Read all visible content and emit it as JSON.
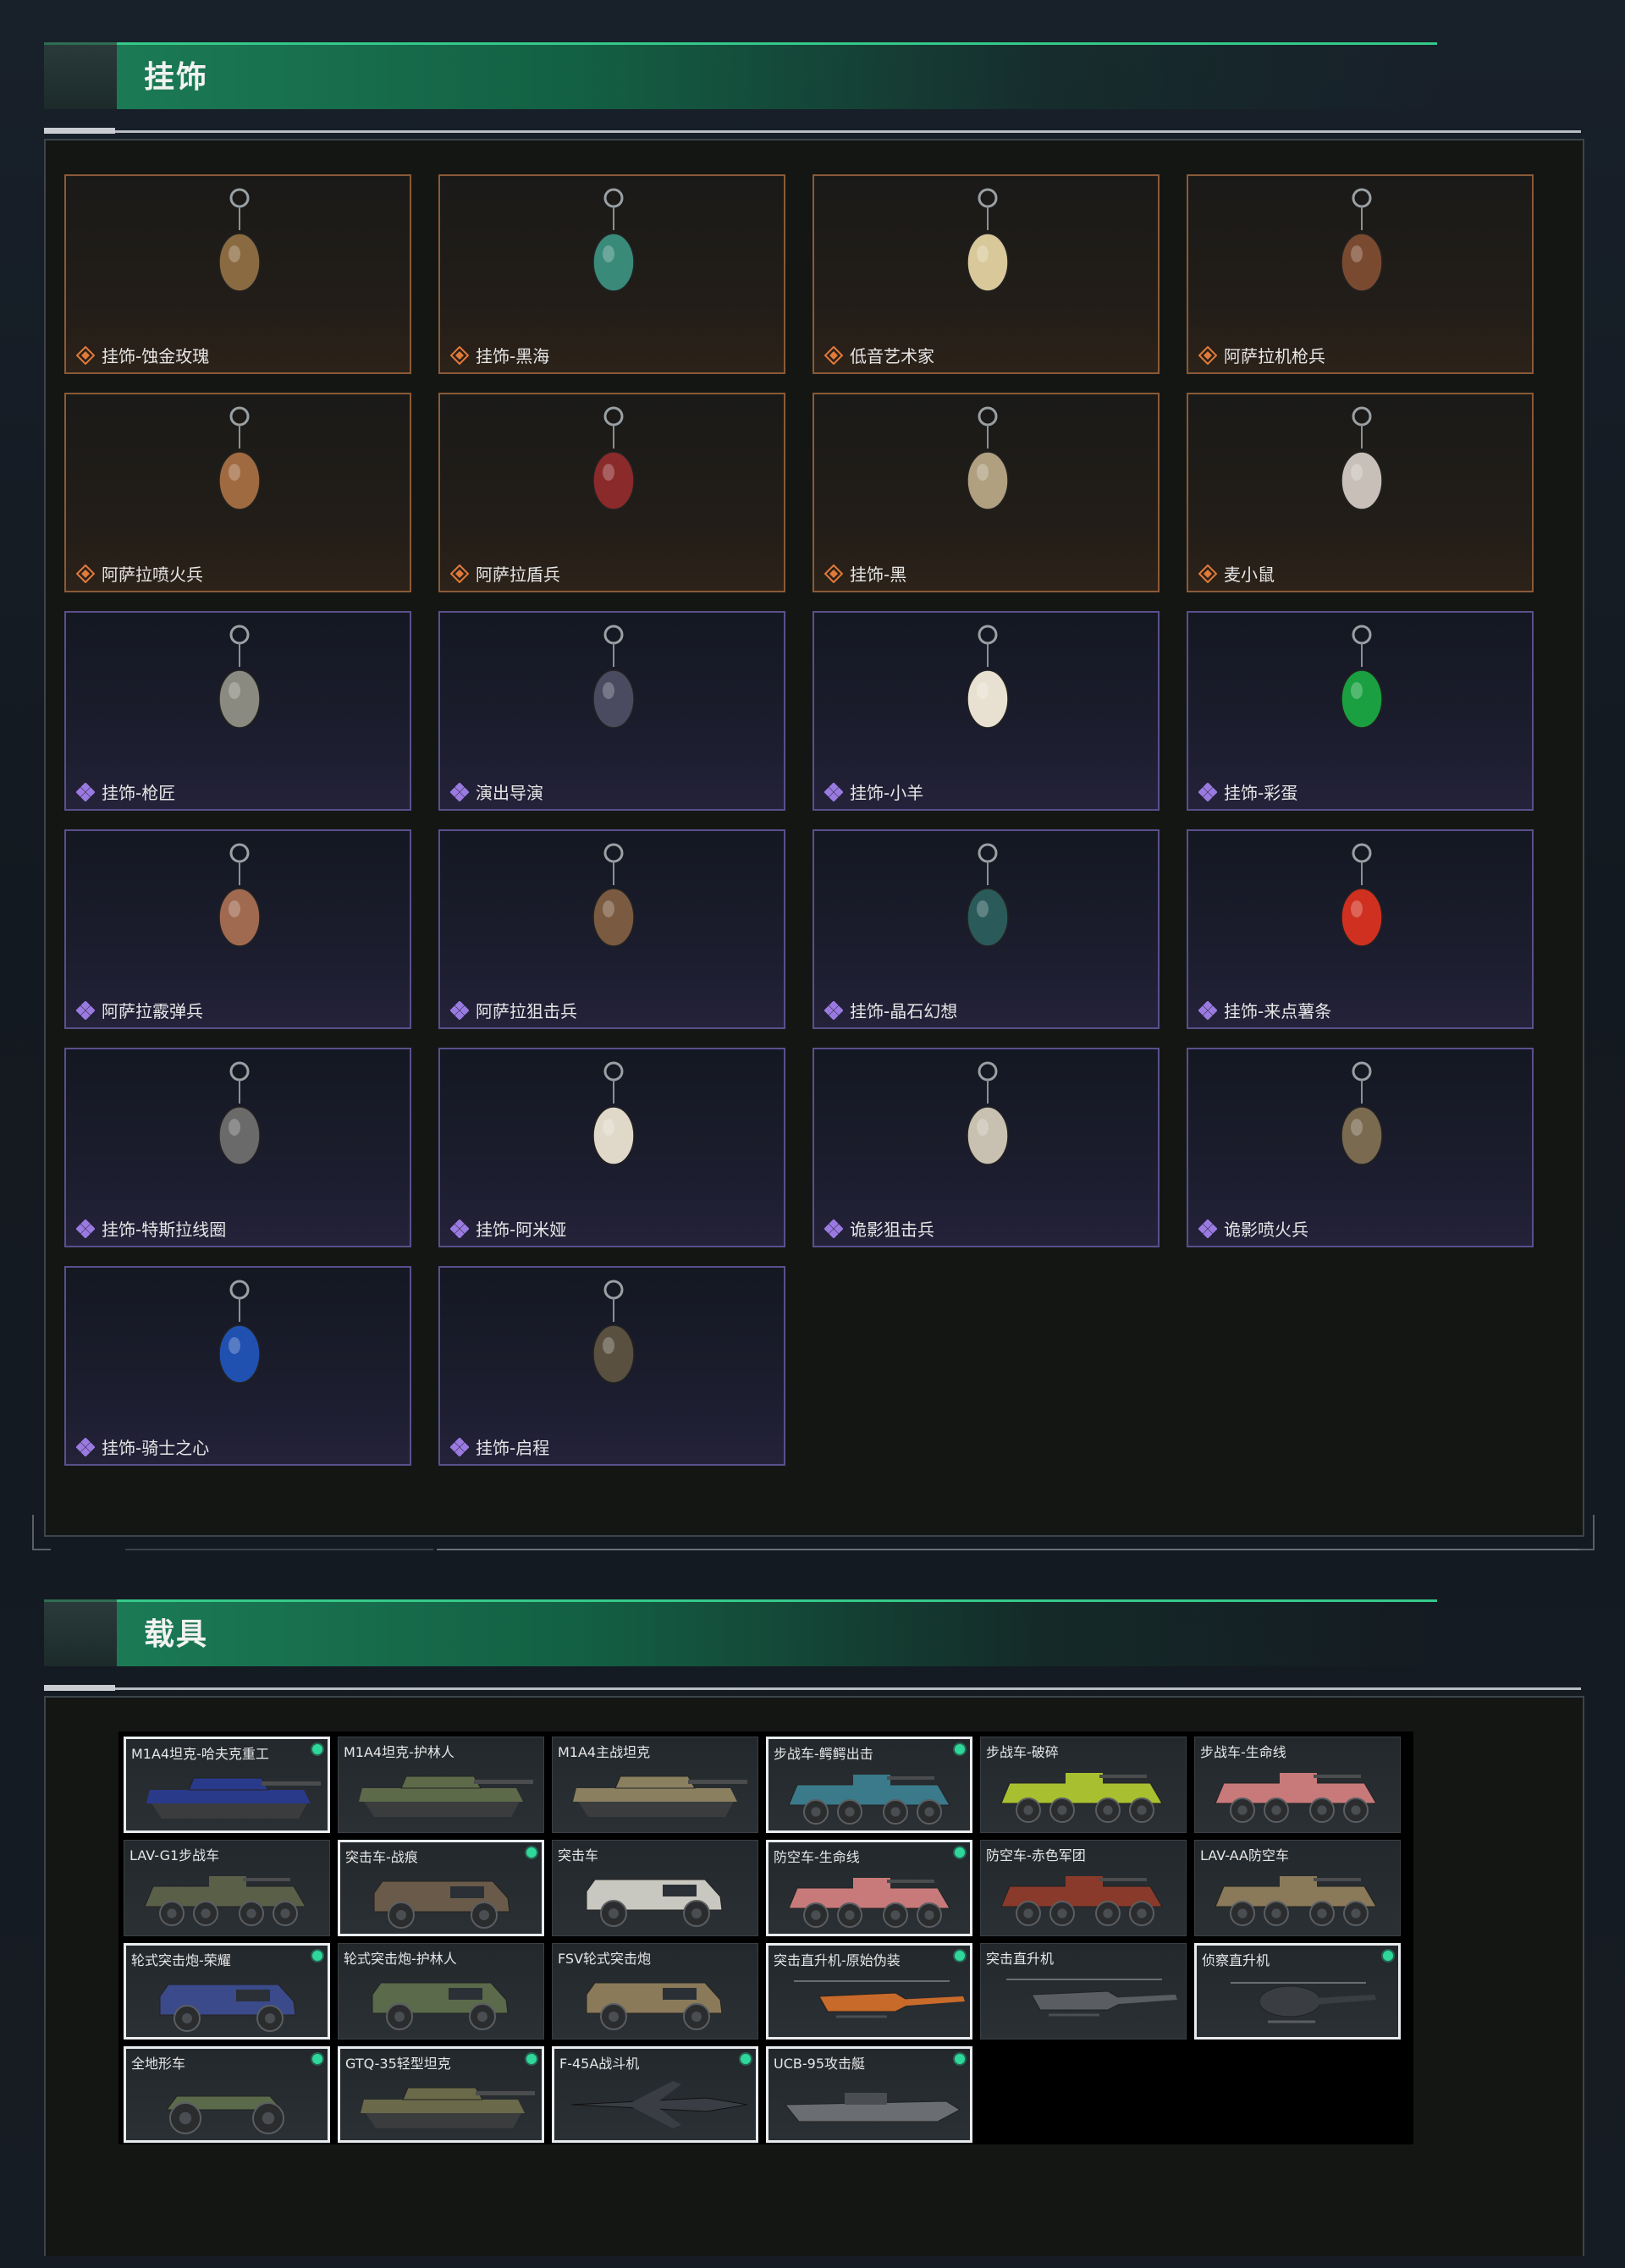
{
  "sections": {
    "charms_title": "挂饰",
    "vehicles_title": "载具"
  },
  "colors": {
    "accent_green": "#1b7a55",
    "legendary_border": "#8a5a37",
    "epic_border": "#5a4f8c",
    "owned_dot": "#2ed89a"
  },
  "charms": [
    {
      "label": "挂饰-蚀金玫瑰",
      "rarity": "legendary",
      "icon": "golden-rose-charm-icon"
    },
    {
      "label": "挂饰-黑海",
      "rarity": "legendary",
      "icon": "anchor-charm-icon"
    },
    {
      "label": "低音艺术家",
      "rarity": "legendary",
      "icon": "bass-artist-charm-icon"
    },
    {
      "label": "阿萨拉机枪兵",
      "rarity": "legendary",
      "icon": "machine-gunner-charm-icon"
    },
    {
      "label": "阿萨拉喷火兵",
      "rarity": "legendary",
      "icon": "flamethrower-charm-icon"
    },
    {
      "label": "阿萨拉盾兵",
      "rarity": "legendary",
      "icon": "shield-soldier-charm-icon"
    },
    {
      "label": "挂饰-黑",
      "rarity": "legendary",
      "icon": "black-charm-icon"
    },
    {
      "label": "麦小鼠",
      "rarity": "legendary",
      "icon": "mouse-charm-icon"
    },
    {
      "label": "挂饰-枪匠",
      "rarity": "epic",
      "icon": "gunsmith-charm-icon"
    },
    {
      "label": "演出导演",
      "rarity": "epic",
      "icon": "director-charm-icon"
    },
    {
      "label": "挂饰-小羊",
      "rarity": "epic",
      "icon": "sheep-charm-icon"
    },
    {
      "label": "挂饰-彩蛋",
      "rarity": "epic",
      "icon": "easter-egg-charm-icon"
    },
    {
      "label": "阿萨拉霰弹兵",
      "rarity": "epic",
      "icon": "shotgunner-charm-icon"
    },
    {
      "label": "阿萨拉狙击兵",
      "rarity": "epic",
      "icon": "sniper-charm-icon"
    },
    {
      "label": "挂饰-晶石幻想",
      "rarity": "epic",
      "icon": "crystal-charm-icon"
    },
    {
      "label": "挂饰-来点薯条",
      "rarity": "epic",
      "icon": "fries-charm-icon"
    },
    {
      "label": "挂饰-特斯拉线圈",
      "rarity": "epic",
      "icon": "tesla-coil-charm-icon"
    },
    {
      "label": "挂饰-阿米娅",
      "rarity": "epic",
      "icon": "amiya-charm-icon"
    },
    {
      "label": "诡影狙击兵",
      "rarity": "epic",
      "icon": "shadow-sniper-charm-icon"
    },
    {
      "label": "诡影喷火兵",
      "rarity": "epic",
      "icon": "shadow-flamethrower-charm-icon"
    },
    {
      "label": "挂饰-骑士之心",
      "rarity": "epic",
      "icon": "knight-heart-charm-icon"
    },
    {
      "label": "挂饰-启程",
      "rarity": "epic",
      "icon": "departure-charm-icon"
    }
  ],
  "vehicles": [
    {
      "label": "M1A4坦克-哈夫克重工",
      "owned": true,
      "kind": "tank",
      "color": "#2a3a8a"
    },
    {
      "label": "M1A4坦克-护林人",
      "owned": false,
      "kind": "tank",
      "color": "#5d6a4a"
    },
    {
      "label": "M1A4主战坦克",
      "owned": false,
      "kind": "tank",
      "color": "#8a8060"
    },
    {
      "label": "步战车-鳄鳄出击",
      "owned": true,
      "kind": "ifv",
      "color": "#3a7a8a"
    },
    {
      "label": "步战车-破碎",
      "owned": false,
      "kind": "ifv",
      "color": "#a8c030"
    },
    {
      "label": "步战车-生命线",
      "owned": false,
      "kind": "ifv",
      "color": "#c87a7a"
    },
    {
      "label": "LAV-G1步战车",
      "owned": false,
      "kind": "ifv",
      "color": "#5a6048"
    },
    {
      "label": "突击车-战痕",
      "owned": true,
      "kind": "truck",
      "color": "#6a5a4a"
    },
    {
      "label": "突击车",
      "owned": false,
      "kind": "truck",
      "color": "#c8c8c0"
    },
    {
      "label": "防空车-生命线",
      "owned": true,
      "kind": "ifv",
      "color": "#c87a7a"
    },
    {
      "label": "防空车-赤色军团",
      "owned": false,
      "kind": "ifv",
      "color": "#8a3a2a"
    },
    {
      "label": "LAV-AA防空车",
      "owned": false,
      "kind": "ifv",
      "color": "#8a7a5a"
    },
    {
      "label": "轮式突击炮-荣耀",
      "owned": true,
      "kind": "truck",
      "color": "#3a4a8a"
    },
    {
      "label": "轮式突击炮-护林人",
      "owned": false,
      "kind": "truck",
      "color": "#5a6a4a"
    },
    {
      "label": "FSV轮式突击炮",
      "owned": false,
      "kind": "truck",
      "color": "#8a7a5a"
    },
    {
      "label": "突击直升机-原始伪装",
      "owned": true,
      "kind": "heli",
      "color": "#c86a2a"
    },
    {
      "label": "突击直升机",
      "owned": false,
      "kind": "heli",
      "color": "#5a5e62"
    },
    {
      "label": "侦察直升机",
      "owned": true,
      "kind": "heli-small",
      "color": "#3a3e42"
    },
    {
      "label": "全地形车",
      "owned": true,
      "kind": "atv",
      "color": "#5a6a4a"
    },
    {
      "label": "GTQ-35轻型坦克",
      "owned": true,
      "kind": "tank",
      "color": "#6a6a4a"
    },
    {
      "label": "F-45A战斗机",
      "owned": true,
      "kind": "jet",
      "color": "#3a3e44"
    },
    {
      "label": "UCB-95攻击艇",
      "owned": true,
      "kind": "boat",
      "color": "#6a6e72"
    }
  ]
}
